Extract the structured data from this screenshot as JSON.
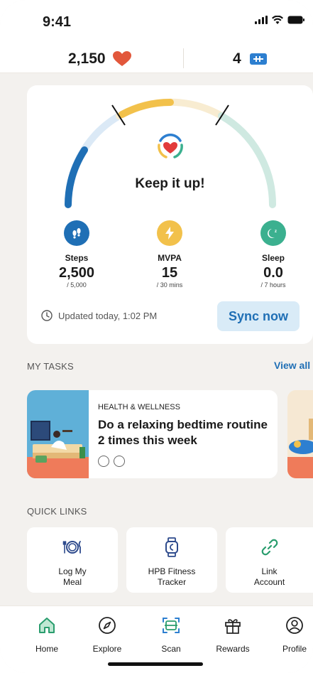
{
  "status_bar": {
    "time": "9:41"
  },
  "header": {
    "points": "2,150",
    "badges": "4"
  },
  "activity": {
    "message": "Keep it up!",
    "steps": {
      "label": "Steps",
      "value": "2,500",
      "goal": "/ 5,000",
      "progress": 0.5
    },
    "mvpa": {
      "label": "MVPA",
      "value": "15",
      "goal": "/ 30 mins",
      "progress": 0.5
    },
    "sleep": {
      "label": "Sleep",
      "value": "0.0",
      "goal": "/ 7 hours",
      "progress": 0.0
    },
    "updated": "Updated today, 1:02 PM",
    "sync_label": "Sync now"
  },
  "tasks": {
    "section_title": "MY TASKS",
    "view_all": "View all",
    "items": [
      {
        "category": "HEALTH & WELLNESS",
        "title": "Do a relaxing bedtime routine 2 times this week",
        "total": 2,
        "done": 0
      }
    ]
  },
  "quick_links": {
    "section_title": "QUICK LINKS",
    "items": [
      {
        "line1": "Log My",
        "line2": "Meal",
        "icon": "meal-icon"
      },
      {
        "line1": "HPB Fitness",
        "line2": "Tracker",
        "icon": "fitness-tracker-icon"
      },
      {
        "line1": "Link",
        "line2": "Account",
        "icon": "link-icon"
      }
    ]
  },
  "nav": {
    "items": [
      {
        "label": "Home",
        "icon": "home-icon",
        "active": true
      },
      {
        "label": "Explore",
        "icon": "compass-icon"
      },
      {
        "label": "Scan",
        "icon": "scan-icon"
      },
      {
        "label": "Rewards",
        "icon": "gift-icon"
      },
      {
        "label": "Profile",
        "icon": "profile-icon"
      }
    ]
  },
  "colors": {
    "steps": "#1f6fb5",
    "mvpa": "#f2c14b",
    "sleep": "#3bb08f",
    "heart": "#e2573b",
    "accent": "#1f6fb5",
    "active_nav": "#2a9d6e"
  }
}
